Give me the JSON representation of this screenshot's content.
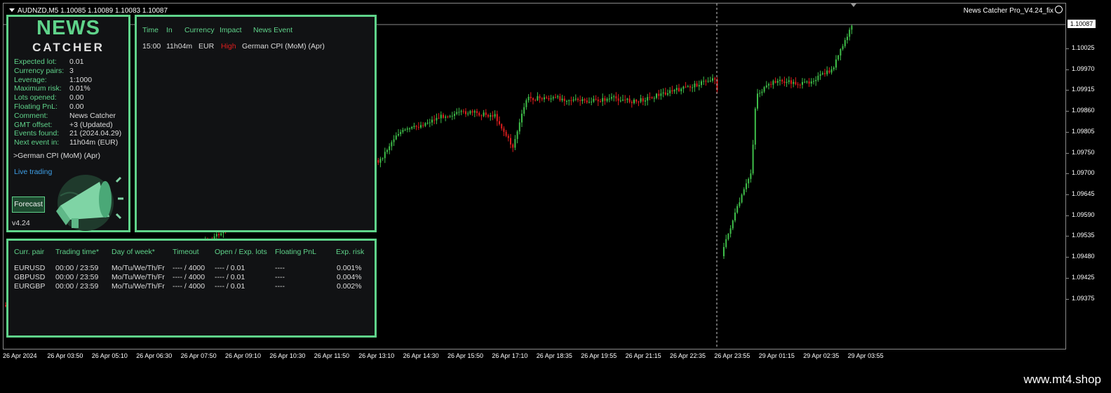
{
  "chart": {
    "title": "AUDNZD,M5  1.10085 1.10089 1.10083 1.10087",
    "ea_label": "News Catcher Pro_V4.24_fix",
    "current_price": "1.10087",
    "price_labels": [
      "1.10025",
      "1.09970",
      "1.09915",
      "1.09860",
      "1.09805",
      "1.09750",
      "1.09700",
      "1.09645",
      "1.09590",
      "1.09535",
      "1.09480",
      "1.09425",
      "1.09375"
    ],
    "time_labels": [
      "26 Apr 2024",
      "26 Apr 03:50",
      "26 Apr 05:10",
      "26 Apr 06:30",
      "26 Apr 07:50",
      "26 Apr 09:10",
      "26 Apr 10:30",
      "26 Apr 11:50",
      "26 Apr 13:10",
      "26 Apr 14:30",
      "26 Apr 15:50",
      "26 Apr 17:10",
      "26 Apr 18:35",
      "26 Apr 19:55",
      "26 Apr 21:15",
      "26 Apr 22:35",
      "26 Apr 23:55",
      "29 Apr 01:15",
      "29 Apr 02:35",
      "29 Apr 03:55"
    ],
    "bull_color": "#3fbf4a",
    "bear_color": "#e01e1e"
  },
  "info_panel": {
    "logo_line1": "NEWS",
    "logo_line2": "CATCHER",
    "rows": [
      {
        "key": "Expected lot:",
        "value": "0.01"
      },
      {
        "key": "Currency pairs:",
        "value": "3"
      },
      {
        "key": "Leverage:",
        "value": "1:1000"
      },
      {
        "key": "Maximum risk:",
        "value": "0.01%"
      },
      {
        "key": "Lots opened:",
        "value": "0.00"
      },
      {
        "key": "Floating PnL:",
        "value": "0.00"
      },
      {
        "key": "Comment:",
        "value": "News Catcher"
      },
      {
        "key": "GMT offset:",
        "value": "+3 (Updated)"
      },
      {
        "key": "Events found:",
        "value": "21 (2024.04.29)"
      },
      {
        "key": "Next event in:",
        "value": "11h04m (EUR)"
      }
    ],
    "next_event_name": ">German CPI (MoM) (Apr)",
    "live_trading": "Live trading",
    "forecast_button": "Forecast",
    "version": "v4.24",
    "accent_color": "#5fd38a"
  },
  "events_panel": {
    "headers": [
      "Time",
      "In",
      "Currency",
      "Impact",
      "News Event"
    ],
    "rows": [
      {
        "time": "15:00",
        "in": "11h04m",
        "currency": "EUR",
        "impact": "High",
        "event": "German CPI (MoM) (Apr)"
      }
    ],
    "impact_high_color": "#e01e1e"
  },
  "pairs_panel": {
    "headers": [
      "Curr. pair",
      "Trading time*",
      "Day of week*",
      "Timeout",
      "Open / Exp. lots",
      "Floating PnL",
      "Exp. risk"
    ],
    "rows": [
      [
        "EURUSD",
        "00:00 / 23:59",
        "Mo/Tu/We/Th/Fr",
        "---- / 4000",
        "---- / 0.01",
        "----",
        "0.001%"
      ],
      [
        "GBPUSD",
        "00:00 / 23:59",
        "Mo/Tu/We/Th/Fr",
        "---- / 4000",
        "---- / 0.01",
        "----",
        "0.004%"
      ],
      [
        "EURGBP",
        "00:00 / 23:59",
        "Mo/Tu/We/Th/Fr",
        "---- / 4000",
        "---- / 0.01",
        "----",
        "0.002%"
      ]
    ]
  },
  "footer": {
    "watermark": "www.mt4.shop"
  }
}
